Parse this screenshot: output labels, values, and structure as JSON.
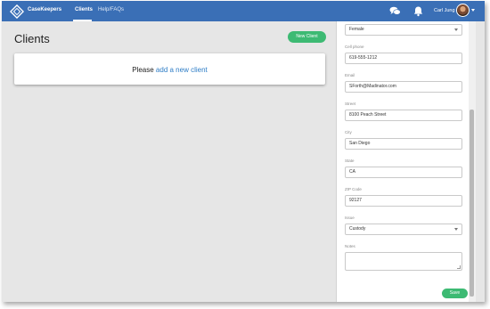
{
  "header": {
    "brand": "CaseKeepers",
    "nav": {
      "clients": "Clients",
      "help": "Help/FAQs"
    },
    "user_name": "Carl Jung",
    "icons": [
      "logo-icon",
      "chat-icon",
      "bell-icon",
      "chevron-down-icon"
    ],
    "color": "#3a6fb6"
  },
  "main": {
    "title": "Clients",
    "new_client_label": "New Client",
    "empty_prefix": "Please ",
    "empty_link": "add a new client"
  },
  "panel": {
    "gender_value": "Female",
    "fields": {
      "cell_phone": {
        "label": "Cell phone",
        "value": "619-555-1212"
      },
      "email": {
        "label": "Email",
        "value": "SForth@Madinator.com"
      },
      "street": {
        "label": "Street",
        "value": "8100 Peach Street"
      },
      "city": {
        "label": "City",
        "value": "San Diego"
      },
      "state": {
        "label": "State",
        "value": "CA"
      },
      "zip": {
        "label": "ZIP Code",
        "value": "92127"
      },
      "issue": {
        "label": "Issue",
        "value": "Custody"
      },
      "notes": {
        "label": "Notes",
        "value": ""
      }
    },
    "save_label": "Save"
  },
  "colors": {
    "accent_green": "#3dba73",
    "link_blue": "#2e7dc6"
  }
}
